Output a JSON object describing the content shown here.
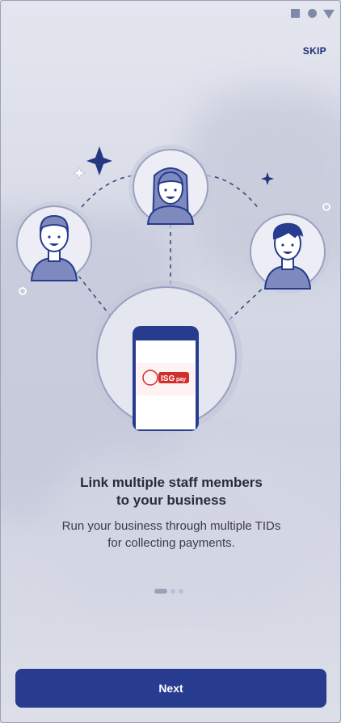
{
  "status_bar": {
    "icons": [
      "square-icon",
      "circle-icon",
      "triangle-icon"
    ]
  },
  "header": {
    "skip_label": "SKIP"
  },
  "illustration": {
    "phone_logo_text": "ISG",
    "phone_logo_subtext": "pay"
  },
  "onboarding": {
    "title_line1": "Link multiple staff members",
    "title_line2": "to your business",
    "subtitle_line1": "Run your business through multiple TIDs",
    "subtitle_line2": "for collecting payments."
  },
  "pager": {
    "current": 1,
    "total": 3
  },
  "footer": {
    "next_label": "Next"
  },
  "colors": {
    "primary": "#283c8f",
    "text": "#2a2d38",
    "accent_red": "#d12e2e"
  }
}
